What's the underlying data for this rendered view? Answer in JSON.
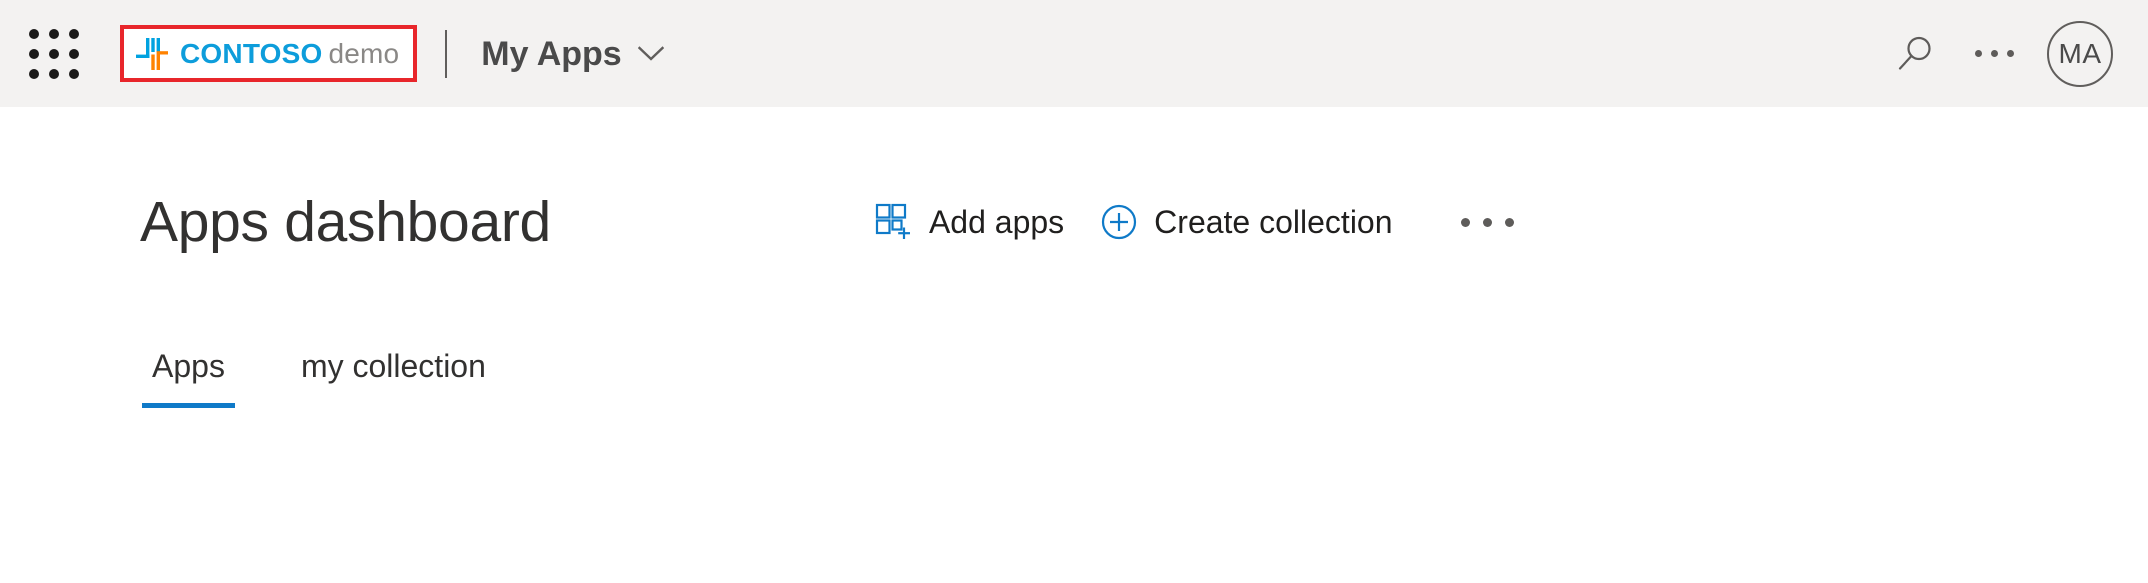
{
  "header": {
    "waffle_icon": "app-launcher-waffle-icon",
    "brand": {
      "logo_icon": "contoso-logo-mark",
      "primary": "CONTOSO",
      "secondary": "demo",
      "highlight_color": "#e8262b",
      "primary_color": "#0d9ddb",
      "secondary_color": "#8a8886"
    },
    "app_name": "My Apps",
    "app_name_chevron_icon": "chevron-down-icon",
    "actions": {
      "search_icon": "search-icon",
      "more_icon": "ellipsis-horizontal-icon",
      "avatar_initials": "MA"
    }
  },
  "main": {
    "title": "Apps dashboard",
    "commands": [
      {
        "label": "Add apps",
        "icon": "add-apps-grid-icon",
        "icon_color": "#0f7ac8"
      },
      {
        "label": "Create collection",
        "icon": "circle-plus-icon",
        "icon_color": "#0f7ac8"
      }
    ],
    "overflow_icon": "ellipsis-horizontal-icon",
    "tabs": [
      {
        "label": "Apps",
        "selected": true
      },
      {
        "label": "my collection",
        "selected": false
      }
    ],
    "accent_color": "#0f7ac8"
  }
}
